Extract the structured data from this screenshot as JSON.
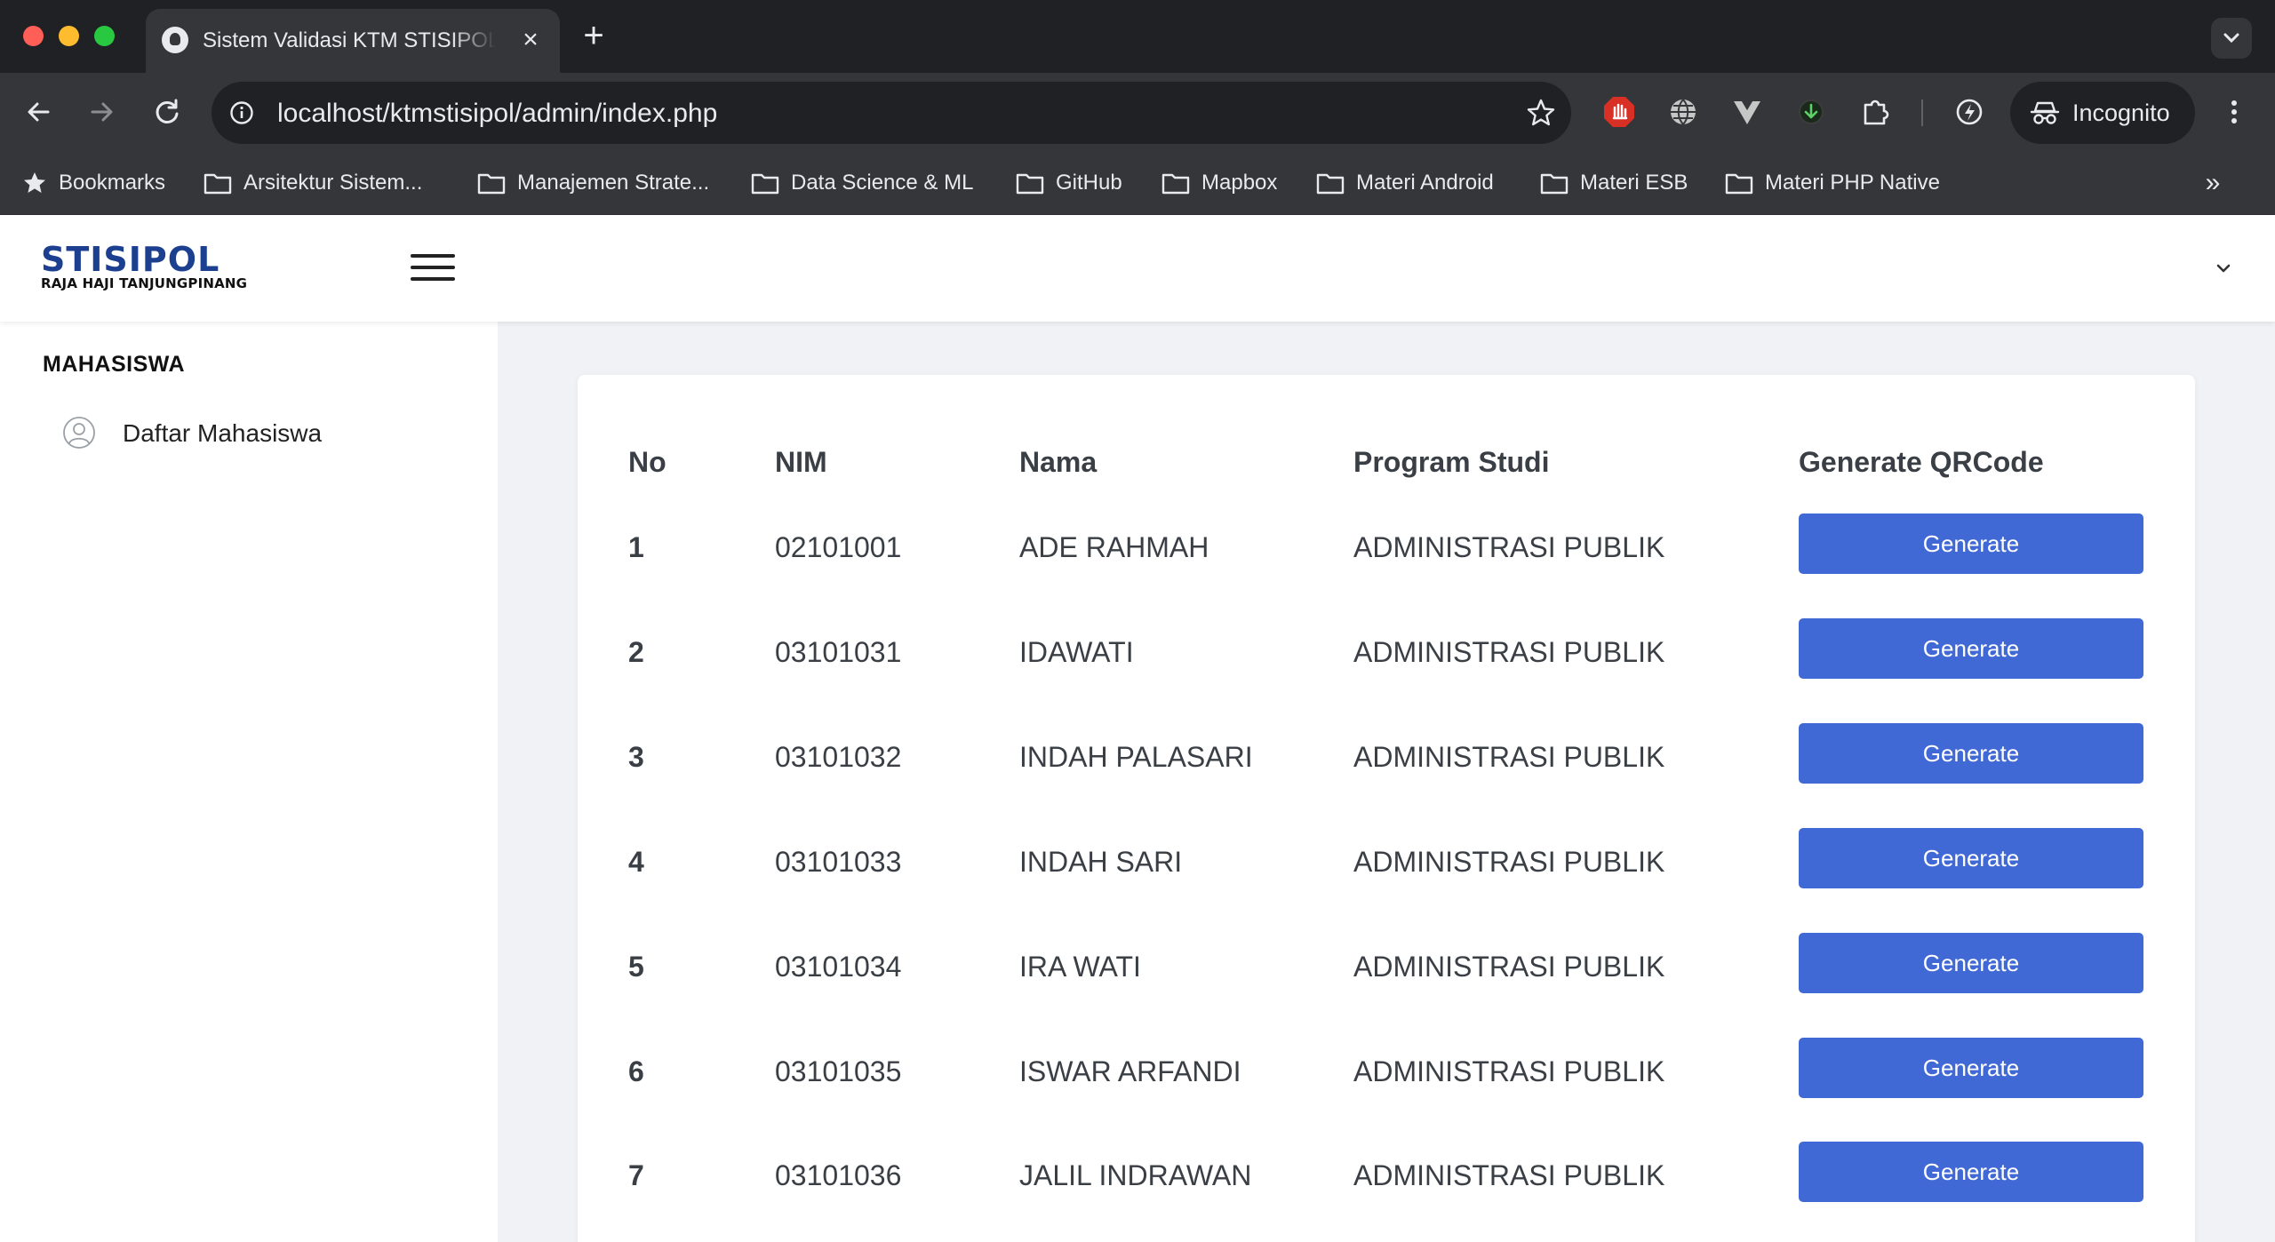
{
  "browser": {
    "tab_title": "Sistem Validasi KTM STISIPOL",
    "url": "localhost/ktmstisipol/admin/index.php",
    "incognito_label": "Incognito",
    "bookmarks": [
      {
        "label": "Bookmarks",
        "icon": "star-icon"
      },
      {
        "label": "Arsitektur Sistem...",
        "icon": "folder-icon"
      },
      {
        "label": "Manajemen Strate...",
        "icon": "folder-icon"
      },
      {
        "label": "Data Science & ML",
        "icon": "folder-icon"
      },
      {
        "label": "GitHub",
        "icon": "folder-icon"
      },
      {
        "label": "Mapbox",
        "icon": "folder-icon"
      },
      {
        "label": "Materi Android",
        "icon": "folder-icon"
      },
      {
        "label": "Materi ESB",
        "icon": "folder-icon"
      },
      {
        "label": "Materi PHP Native",
        "icon": "folder-icon"
      }
    ],
    "more_bookmarks": "»"
  },
  "app": {
    "logo_main": "STISIPOL",
    "logo_sub": "RAJA HAJI TANJUNGPINANG",
    "brand_color": "#1c3f8f",
    "accent_color": "#4169d6"
  },
  "sidebar": {
    "heading": "MAHASISWA",
    "items": [
      {
        "label": "Daftar Mahasiswa",
        "icon": "user-circle-icon"
      }
    ]
  },
  "table": {
    "headers": [
      "No",
      "NIM",
      "Nama",
      "Program Studi",
      "Generate QRCode"
    ],
    "button_label": "Generate",
    "rows": [
      {
        "no": "1",
        "nim": "02101001",
        "nama": "ADE RAHMAH",
        "prodi": "ADMINISTRASI PUBLIK"
      },
      {
        "no": "2",
        "nim": "03101031",
        "nama": "IDAWATI",
        "prodi": "ADMINISTRASI PUBLIK"
      },
      {
        "no": "3",
        "nim": "03101032",
        "nama": "INDAH PALASARI",
        "prodi": "ADMINISTRASI PUBLIK"
      },
      {
        "no": "4",
        "nim": "03101033",
        "nama": "INDAH SARI",
        "prodi": "ADMINISTRASI PUBLIK"
      },
      {
        "no": "5",
        "nim": "03101034",
        "nama": "IRA WATI",
        "prodi": "ADMINISTRASI PUBLIK"
      },
      {
        "no": "6",
        "nim": "03101035",
        "nama": "ISWAR ARFANDI",
        "prodi": "ADMINISTRASI PUBLIK"
      },
      {
        "no": "7",
        "nim": "03101036",
        "nama": "JALIL INDRAWAN",
        "prodi": "ADMINISTRASI PUBLIK"
      }
    ]
  }
}
